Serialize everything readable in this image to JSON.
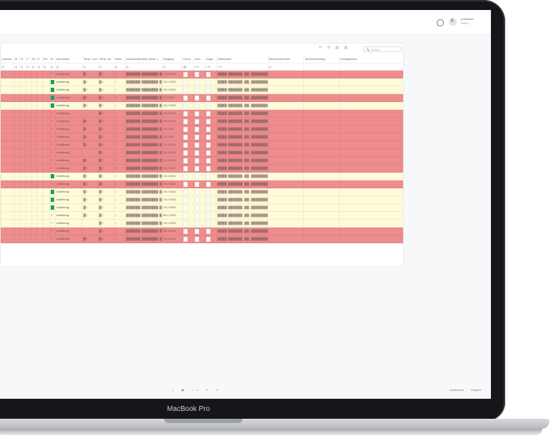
{
  "device": {
    "label": "MacBook Pro"
  },
  "topbar": {
    "user_initial": "R.",
    "user_name": "p.fieldbloc",
    "user_role": "Admin"
  },
  "toolbar": {
    "icons": "⟳ ⇅ ▤ ▥",
    "search_placeholder": "🔍 Suchen..."
  },
  "colors": {
    "red_row": "#ee8c8e",
    "yellow_row": "#fdfbd8",
    "green_check": "#1f9c6a"
  },
  "table": {
    "headers": [
      "tnahme",
      "M",
      "N",
      "C",
      "E1",
      "E",
      "EN",
      "M",
      "Abschluss",
      "Temp. Soll",
      "Temp. Ist",
      "Delta",
      "Adresse/Bauteile (Stall...)",
      "Eingang",
      "Druck",
      "Ann...",
      "Abga...",
      "Dateiname",
      "Benutzerbemerk",
      "Tankbemerkung",
      "Schlagwörter"
    ],
    "filters": [
      "Q",
      "Q",
      "Q",
      "Q",
      "Q",
      "Q",
      "Q",
      "Q",
      "Q",
      "Q",
      "Q",
      "Q",
      "Q",
      "Q",
      "▤",
      "L ▾",
      "L ▾",
      "L ▾",
      "Q",
      "",
      "",
      "Q"
    ],
    "rows": [
      {
        "color": "red",
        "marks": "- - - - - -",
        "status": "?",
        "abschluss": "Umleitung",
        "ts": "█0",
        "ti": "█0",
        "d": "1",
        "addr": "██████ ███████ ███ · ███",
        "eingang": "19.2.2021",
        "file": "████ ██████_██_███████_██ ██████"
      },
      {
        "color": "yellow",
        "marks": "- - - - - -",
        "status": "✓",
        "abschluss": "Umleitung",
        "ts": "█0",
        "ti": "█0",
        "d": "1",
        "addr": "██████ ███████ ███ · ███",
        "eingang": "19.2.2021",
        "file": "████ ██████_██_███████_██ ██████"
      },
      {
        "color": "yellow",
        "marks": "- - - - - -",
        "status": "✓",
        "abschluss": "Umleitung",
        "ts": "█0",
        "ti": "█0",
        "d": "1",
        "addr": "██████ ███████ ███ · ███",
        "eingang": "19.2.2021",
        "file": "████ ██████_██_███████_██ ██████"
      },
      {
        "color": "red",
        "marks": "- - - - - -",
        "status": "✓",
        "abschluss": "Umleitung",
        "ts": "█0",
        "ti": "█0",
        "d": "1",
        "addr": "██████ ███████ ███ · ███",
        "eingang": "5.3.2021",
        "file": "████ ██████_██_███████_██ ██████"
      },
      {
        "color": "yellow",
        "marks": "- - - - - -",
        "status": "✓",
        "abschluss": "Umleitung",
        "ts": "█0",
        "ti": "█0",
        "d": "1",
        "addr": "██████ ███████ ███ · ███",
        "eingang": "19.2.2021",
        "file": "████ ██████_██_███████_██ ██████"
      },
      {
        "color": "red",
        "marks": "- - - - - -",
        "status": "?",
        "abschluss": "Umleitung",
        "ts": "",
        "ti": "█0",
        "d": "1",
        "addr": "██████ ███████ ███ · ███",
        "eingang": "24.2.2021",
        "file": "████ ██████_██_███████_██ ██████"
      },
      {
        "color": "red",
        "marks": "- - - - - -",
        "status": "?",
        "abschluss": "Umleitung",
        "ts": "█0",
        "ti": "█0",
        "d": "1",
        "addr": "██████ ███████ ███ · ███",
        "eingang": "24.2.2021",
        "file": "████ ██████_██_███████_██ ██████"
      },
      {
        "color": "red",
        "marks": "- - - - - -",
        "status": "?",
        "abschluss": "Umleitung",
        "ts": "█0",
        "ti": "█0",
        "d": "1",
        "addr": "██████ ███████ ███ · ███",
        "eingang": "5.3.2021",
        "file": "████ ██████_██_███████_██ ██████"
      },
      {
        "color": "red",
        "marks": "- - - - - -",
        "status": "?",
        "abschluss": "Umleitung",
        "ts": "█0",
        "ti": "█0",
        "d": "1",
        "addr": "██████ ███████ ███ · ███",
        "eingang": "5.3.2021",
        "file": "████ ██████_██_███████_██ ██████"
      },
      {
        "color": "red",
        "marks": "- - - - - -",
        "status": "?",
        "abschluss": "Umleitung",
        "ts": "█0",
        "ti": "█0",
        "d": "1",
        "addr": "██████ ███████ ███ · ███",
        "eingang": "24.2.2021",
        "file": "████ ██████_██_███████_██ ██████"
      },
      {
        "color": "red",
        "marks": "- - - - - -",
        "status": "?",
        "abschluss": "Umleitung",
        "ts": "",
        "ti": "█0",
        "d": "1",
        "addr": "██████ ███████ ███ · ███",
        "eingang": "24.2.2021",
        "file": "████ ██████_██_███████_██ ██████"
      },
      {
        "color": "red",
        "marks": "- - - - - -",
        "status": "?",
        "abschluss": "Umleitung",
        "ts": "█0",
        "ti": "█0",
        "d": "1",
        "addr": "██████ ███████ ███ · ███",
        "eingang": "24.2.2021",
        "file": "████ ██████_██_███████_██ ██████"
      },
      {
        "color": "red",
        "marks": "- - - - - -",
        "status": "?",
        "abschluss": "Umleitung",
        "ts": "█0",
        "ti": "█0",
        "d": "1",
        "addr": "██████ ███████ ███ · ███",
        "eingang": "24.2.2021",
        "file": "████ ██████_██_███████_██ ██████"
      },
      {
        "color": "yellow",
        "marks": "- - - - - -",
        "status": "✓",
        "abschluss": "Umleitung",
        "ts": "█0",
        "ti": "█0",
        "d": "1",
        "addr": "██████ ███████ ███ · ███",
        "eingang": "19.2.2021",
        "file": "████ ██████_██_███████_██ ██████"
      },
      {
        "color": "red",
        "marks": "- - - - - -",
        "status": "?",
        "abschluss": "Umleitung",
        "ts": "█0",
        "ti": "█0",
        "d": "1",
        "addr": "██████ ███████ ███ · ███",
        "eingang": "19.2.2021",
        "file": "████ ██████_██_███████_██ ██████"
      },
      {
        "color": "yellow",
        "marks": "- - - - - -",
        "status": "✓",
        "abschluss": "Umleitung",
        "ts": "█0",
        "ti": "█0",
        "d": "1",
        "addr": "██████ ███████ ███ · ███",
        "eingang": "19.2.2021",
        "file": "████ ██████_██_███████_██ ██████"
      },
      {
        "color": "yellow",
        "marks": "- - - - - -",
        "status": "✓",
        "abschluss": "Umleitung",
        "ts": "█0",
        "ti": "█0",
        "d": "1",
        "addr": "██████ ███████ ███ · ███",
        "eingang": "19.2.2021",
        "file": "████ ██████_██_███████_██ ██████"
      },
      {
        "color": "yellow",
        "marks": "- - - - - -",
        "status": "✓",
        "abschluss": "Umleitung",
        "ts": "█0",
        "ti": "█0",
        "d": "1",
        "addr": "██████ ███████ ███ · ███",
        "eingang": "19.2.2021",
        "file": "████ ██████_██_███████_██ ██████"
      },
      {
        "color": "yellow",
        "marks": "- - - - - -",
        "status": "?",
        "abschluss": "Umleitung",
        "ts": "█0",
        "ti": "█0",
        "d": "1",
        "addr": "██████ ███████ ███ · ███",
        "eingang": "30.1.2021",
        "file": "████ ██████_██_███████_██ ██████"
      },
      {
        "color": "yellow",
        "marks": "- - - - - -",
        "status": "?",
        "abschluss": "Umleitung",
        "ts": "",
        "ti": "█0",
        "d": "1",
        "addr": "██████ ███████ ███ · ███",
        "eingang": "19.2.2021",
        "file": "████ ██████_██_███████_██ ██████"
      },
      {
        "color": "red",
        "marks": "- - - - - -",
        "status": "?",
        "abschluss": "Umleitung",
        "ts": "",
        "ti": "█0",
        "d": "1",
        "addr": "██████ ███████ ███ · ███",
        "eingang": "24.2.2021",
        "file": "████ ██████_██_███████_██ ██████"
      },
      {
        "color": "red",
        "marks": "- - - - - -",
        "status": "?",
        "abschluss": "Umleitung",
        "ts": "█0",
        "ti": "█0",
        "d": "1",
        "addr": "██████ ███████ ███ · ███",
        "eingang": "24.2.2021",
        "file": "████ ██████_██_███████_██ ██████"
      }
    ]
  },
  "footer": {
    "social_icons": "f ▣ in ✦ ⊙",
    "impressum": "Impressum",
    "support": "Support"
  }
}
